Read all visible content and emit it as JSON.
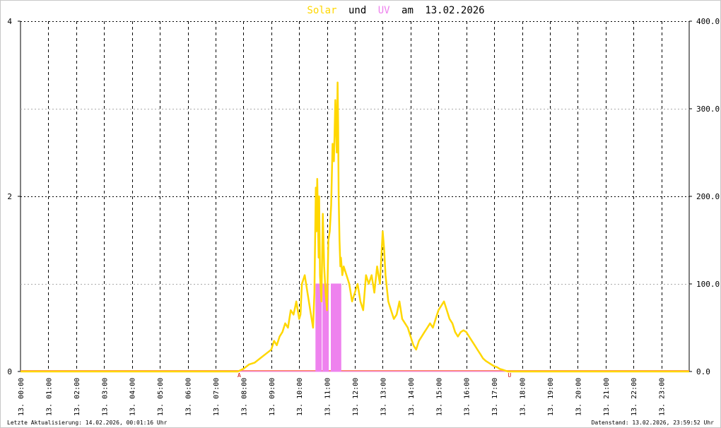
{
  "title": {
    "word_solar": "Solar",
    "word_und": "und",
    "word_uv": "UV",
    "word_am": "am",
    "date": "13.02.2026"
  },
  "footer": {
    "last_update": "Letzte Aktualisierung: 14.02.2026, 00:01:16 Uhr",
    "data_status": "Datenstand: 13.02.2026, 23:59:52 Uhr"
  },
  "colors": {
    "solar": "#FFD700",
    "uv": "#EE82EE",
    "baseline": "#FF8C69",
    "marker": "#CC0000",
    "grid": "#000000",
    "minor_grid": "#AAAAAA",
    "text": "#000000"
  },
  "chart_data": {
    "type": "line",
    "x_unit": "hour of day",
    "xlim": [
      0,
      24
    ],
    "x_tick_labels": [
      "13. 00:00",
      "13. 01:00",
      "13. 02:00",
      "13. 03:00",
      "13. 04:00",
      "13. 05:00",
      "13. 06:00",
      "13. 07:00",
      "13. 08:00",
      "13. 09:00",
      "13. 10:00",
      "13. 11:00",
      "13. 12:00",
      "13. 13:00",
      "13. 14:00",
      "13. 15:00",
      "13. 16:00",
      "13. 17:00",
      "13. 18:00",
      "13. 19:00",
      "13. 20:00",
      "13. 21:00",
      "13. 22:00",
      "13. 23:00"
    ],
    "y_left": {
      "lim": [
        0,
        4
      ],
      "ticks": [
        "0",
        "2",
        "4"
      ]
    },
    "y_right": {
      "lim": [
        0,
        400
      ],
      "ticks": [
        "0.0",
        "100.0",
        "200.0",
        "300.0",
        "400.0"
      ]
    },
    "markers": [
      {
        "label": "A",
        "x": 7.85
      },
      {
        "label": "U",
        "x": 17.55
      }
    ],
    "series": [
      {
        "name": "Solar",
        "axis": "right",
        "x": [
          0,
          7.8,
          8.0,
          8.2,
          8.4,
          8.6,
          8.8,
          9.0,
          9.1,
          9.2,
          9.3,
          9.4,
          9.5,
          9.6,
          9.7,
          9.8,
          9.9,
          10.0,
          10.05,
          10.1,
          10.2,
          10.3,
          10.4,
          10.45,
          10.5,
          10.55,
          10.6,
          10.62,
          10.65,
          10.7,
          10.72,
          10.75,
          10.8,
          10.85,
          10.9,
          10.95,
          11.0,
          11.05,
          11.1,
          11.15,
          11.2,
          11.25,
          11.3,
          11.35,
          11.38,
          11.4,
          11.42,
          11.45,
          11.48,
          11.5,
          11.55,
          11.6,
          11.7,
          11.8,
          11.9,
          12.0,
          12.1,
          12.2,
          12.3,
          12.4,
          12.5,
          12.6,
          12.7,
          12.8,
          12.9,
          13.0,
          13.05,
          13.1,
          13.2,
          13.3,
          13.4,
          13.5,
          13.6,
          13.7,
          13.8,
          13.9,
          14.0,
          14.1,
          14.2,
          14.3,
          14.4,
          14.5,
          14.6,
          14.7,
          14.8,
          14.9,
          15.0,
          15.1,
          15.2,
          15.3,
          15.4,
          15.5,
          15.6,
          15.7,
          15.8,
          15.9,
          16.0,
          16.1,
          16.2,
          16.3,
          16.4,
          16.5,
          16.6,
          16.7,
          16.8,
          16.9,
          17.0,
          17.1,
          17.2,
          17.3,
          17.4,
          17.5,
          17.6,
          24
        ],
        "values": [
          0,
          0,
          3,
          8,
          10,
          15,
          20,
          25,
          35,
          30,
          40,
          45,
          55,
          50,
          70,
          65,
          80,
          60,
          65,
          100,
          110,
          90,
          70,
          60,
          50,
          90,
          210,
          160,
          220,
          130,
          200,
          110,
          80,
          180,
          120,
          90,
          70,
          150,
          160,
          190,
          260,
          240,
          310,
          250,
          330,
          280,
          200,
          150,
          120,
          130,
          110,
          120,
          110,
          100,
          80,
          90,
          100,
          80,
          70,
          110,
          100,
          110,
          90,
          120,
          100,
          160,
          140,
          110,
          80,
          70,
          60,
          65,
          80,
          60,
          55,
          50,
          40,
          30,
          25,
          35,
          40,
          45,
          50,
          55,
          50,
          60,
          70,
          75,
          80,
          70,
          60,
          55,
          45,
          40,
          45,
          47,
          45,
          40,
          35,
          30,
          25,
          20,
          15,
          12,
          10,
          8,
          6,
          5,
          3,
          2,
          1,
          0,
          0,
          0
        ]
      },
      {
        "name": "UV",
        "axis": "left",
        "x": [
          0,
          10.6,
          10.6,
          10.8,
          10.8,
          10.85,
          10.85,
          11.05,
          11.05,
          11.15,
          11.15,
          11.5,
          11.5,
          11.65,
          11.65,
          24
        ],
        "values": [
          0,
          0,
          1,
          1,
          0,
          0,
          1,
          1,
          0,
          0,
          1,
          1,
          0,
          0,
          0,
          0
        ]
      }
    ]
  }
}
